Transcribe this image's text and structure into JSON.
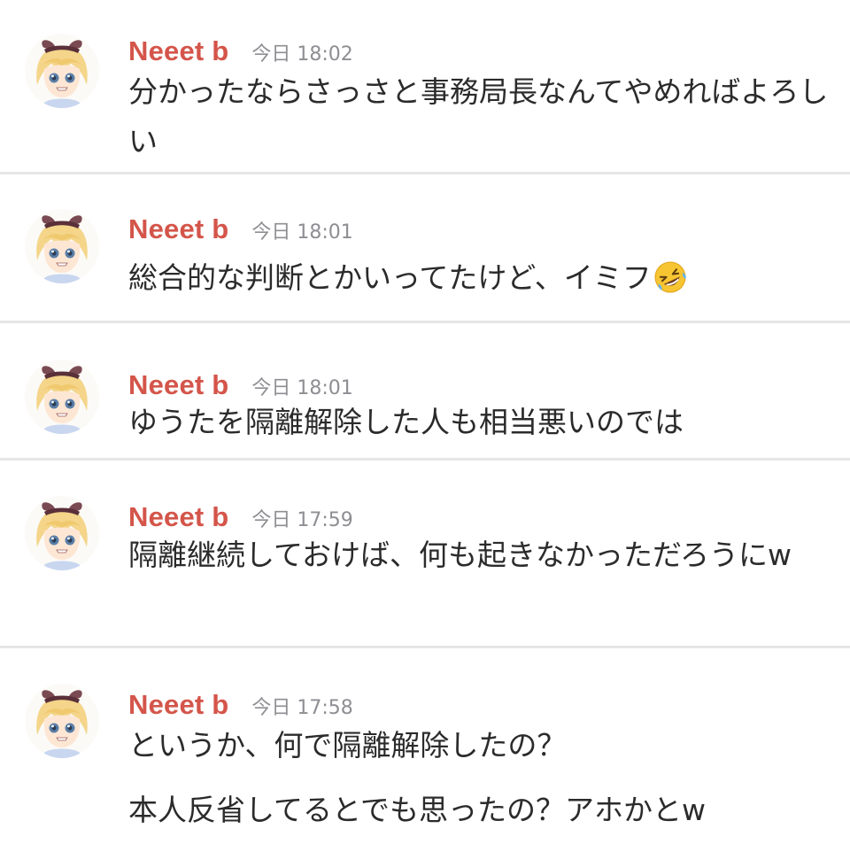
{
  "messages": [
    {
      "author": "Neeet b",
      "time": "今日 18:02",
      "lines": [
        "分かったならさっさと事務局長なんてやめればよろしい"
      ]
    },
    {
      "author": "Neeet b",
      "time": "今日 18:01",
      "lines": [
        "総合的な判断とかいってたけど、イミフ"
      ],
      "emoji": "rolling-on-floor-laughing-emoji"
    },
    {
      "author": "Neeet b",
      "time": "今日 18:01",
      "lines": [
        "ゆうたを隔離解除した人も相当悪いのでは"
      ]
    },
    {
      "author": "Neeet b",
      "time": "今日 17:59",
      "lines": [
        "隔離継続しておけば、何も起きなかっただろうにw"
      ]
    },
    {
      "author": "Neeet b",
      "time": "今日 17:58",
      "lines": [
        "というか、何で隔離解除したの？",
        "本人反省してるとでも思ったの？アホかとw"
      ]
    }
  ],
  "colors": {
    "author": "#d4554a",
    "timestamp": "#8e8e93",
    "text": "#2b2b2b",
    "divider": "#e6e6e8",
    "background": "#ffffff"
  },
  "icons": {
    "avatar": "anime-avatar-icon"
  }
}
